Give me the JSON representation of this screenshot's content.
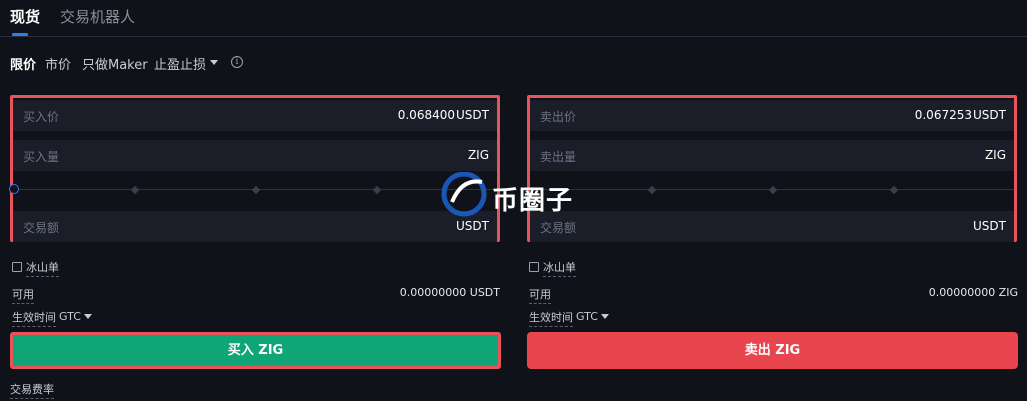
{
  "tabs": [
    {
      "label": "现货",
      "active": true
    },
    {
      "label": "交易机器人",
      "active": false
    }
  ],
  "order_types": [
    {
      "label": "限价",
      "active": true
    },
    {
      "label": "市价",
      "active": false
    },
    {
      "label": "只做Maker",
      "active": false
    },
    {
      "label": "止盈止损",
      "active": false,
      "dropdown": true
    }
  ],
  "buy": {
    "price": {
      "label": "买入价",
      "value": "0.068400",
      "unit": "USDT"
    },
    "amount": {
      "label": "买入量",
      "value": "",
      "unit": "ZIG"
    },
    "total": {
      "label": "交易额",
      "value": "",
      "unit": "USDT"
    },
    "slider_percent": 0,
    "iceberg_label": "冰山单",
    "available_label": "可用",
    "available_value": "0.00000000 USDT",
    "tif_label": "生效时间",
    "tif_value": "GTC",
    "button_label": "买入 ZIG"
  },
  "sell": {
    "price": {
      "label": "卖出价",
      "value": "0.067253",
      "unit": "USDT"
    },
    "amount": {
      "label": "卖出量",
      "value": "",
      "unit": "ZIG"
    },
    "total": {
      "label": "交易额",
      "value": "",
      "unit": "USDT"
    },
    "slider_percent": 0,
    "iceberg_label": "冰山单",
    "available_label": "可用",
    "available_value": "0.00000000 ZIG",
    "tif_label": "生效时间",
    "tif_value": "GTC",
    "button_label": "卖出 ZIG"
  },
  "fee_label": "交易费率",
  "watermark": "币圈子",
  "colors": {
    "background": "#10121a",
    "accent": "#2f7bf0",
    "buy": "#0fa577",
    "sell": "#e8454f",
    "highlight": "#e8545c"
  }
}
